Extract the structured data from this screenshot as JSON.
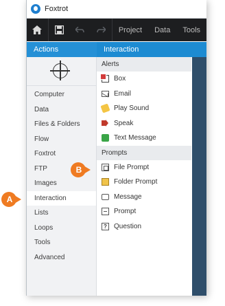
{
  "app": {
    "title": "Foxtrot"
  },
  "toolbar": {
    "menus": [
      "Project",
      "Data",
      "Tools"
    ]
  },
  "left": {
    "header": "Actions",
    "categories": [
      {
        "label": "Computer",
        "active": false
      },
      {
        "label": "Data",
        "active": false
      },
      {
        "label": "Files & Folders",
        "active": false
      },
      {
        "label": "Flow",
        "active": false
      },
      {
        "label": "Foxtrot",
        "active": false
      },
      {
        "label": "FTP",
        "active": false
      },
      {
        "label": "Images",
        "active": false
      },
      {
        "label": "Interaction",
        "active": true
      },
      {
        "label": "Lists",
        "active": false
      },
      {
        "label": "Loops",
        "active": false
      },
      {
        "label": "Tools",
        "active": false
      },
      {
        "label": "Advanced",
        "active": false
      }
    ]
  },
  "right": {
    "header": "Interaction",
    "groups": [
      {
        "label": "Alerts",
        "items": [
          {
            "label": "Box",
            "icon": "box-icon"
          },
          {
            "label": "Email",
            "icon": "email-icon"
          },
          {
            "label": "Play Sound",
            "icon": "sound-icon"
          },
          {
            "label": "Speak",
            "icon": "speak-icon"
          },
          {
            "label": "Text Message",
            "icon": "text-message-icon"
          }
        ]
      },
      {
        "label": "Prompts",
        "items": [
          {
            "label": "File Prompt",
            "icon": "file-prompt-icon"
          },
          {
            "label": "Folder Prompt",
            "icon": "folder-prompt-icon"
          },
          {
            "label": "Message",
            "icon": "message-icon"
          },
          {
            "label": "Prompt",
            "icon": "prompt-icon"
          },
          {
            "label": "Question",
            "icon": "question-icon"
          }
        ]
      }
    ]
  },
  "callouts": {
    "a": "A",
    "b": "B"
  },
  "colors": {
    "accent": "#1d8bd2",
    "callout": "#ef7b22",
    "toolbar": "#1d1e20"
  }
}
